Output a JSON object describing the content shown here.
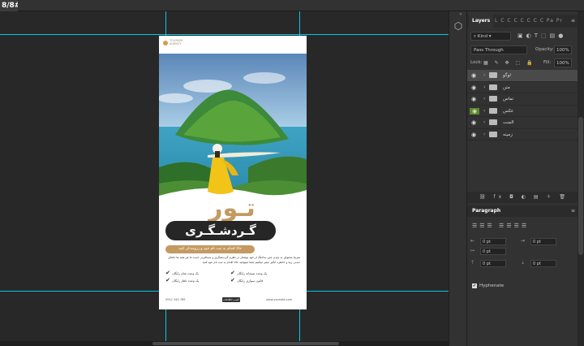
{
  "document": {
    "tab_label": "8/8#)"
  },
  "poster": {
    "logo_text": "TOURISM AGENCY",
    "title": "تـور",
    "subtitle": "گـردشـگـری",
    "tagline": "حالا اقدام به ثبت نام خود و رزومه‌تان کنید",
    "paragraph": "تمرینا محتوای به چیدن متن ساختگ از خود نوشتار در نظرم گرده‌شگری و مسافرتی است ما هر همه ها جاهای دیدنی زیبا و خاطره انگیز سفر میکنیم شما میتوانید حالا اقدام به ثبت نام خود کنید",
    "features": [
      "یک وعده شام رایگان",
      "یک وعده صبحانه رایگان",
      "یک وعده ناهار رایگان",
      "قانون سواری رایگان"
    ],
    "phone": "0912 345 789",
    "button": "کسب اطلاعات",
    "website": "www.yoursite.com"
  },
  "panel": {
    "active_tab": "Layers",
    "other_tabs": "L C C C C C C C  Pa  Pr",
    "menu_icon": "≡",
    "kind": "Kind",
    "blend_mode": "Pass Through",
    "opacity_label": "Opacity:",
    "opacity_value": "100%",
    "lock_label": "Lock:",
    "fill_label": "Fill:",
    "fill_value": "100%",
    "layers": [
      {
        "name": "لوگو",
        "selected": true,
        "eye_green": false
      },
      {
        "name": "متن",
        "selected": false,
        "eye_green": false
      },
      {
        "name": "تماس",
        "selected": false,
        "eye_green": false
      },
      {
        "name": "عکس",
        "selected": false,
        "eye_green": true
      },
      {
        "name": "المنت",
        "selected": false,
        "eye_green": false
      },
      {
        "name": "زمینه",
        "selected": false,
        "eye_green": false
      }
    ],
    "bottom_icons": "⛓ fx ◘ ◐ ▤ ＋ 🗑"
  },
  "paragraph_panel": {
    "title": "Paragraph",
    "menu_icon": "≡",
    "fields": [
      "0 pt",
      "0 pt",
      "0 pt",
      "0 pt",
      "0 pt"
    ],
    "hyphenate": "Hyphenate"
  },
  "colors": {
    "accent_gold": "#c49a61",
    "dark": "#262626",
    "guide": "#00c8e8"
  }
}
